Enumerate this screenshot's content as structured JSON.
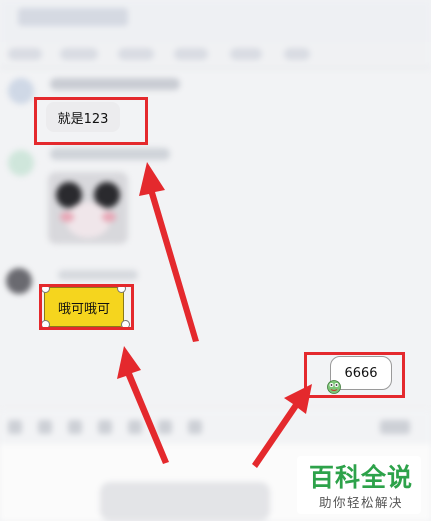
{
  "messages": {
    "first": "就是123",
    "yellow": "哦可哦可",
    "white": "6666"
  },
  "watermark": {
    "main": "百科全说",
    "sub": "助你轻松解决"
  },
  "colors": {
    "highlight_red": "#e4292d",
    "bubble_yellow": "#f5d51e",
    "watermark_green": "#2da24a"
  }
}
